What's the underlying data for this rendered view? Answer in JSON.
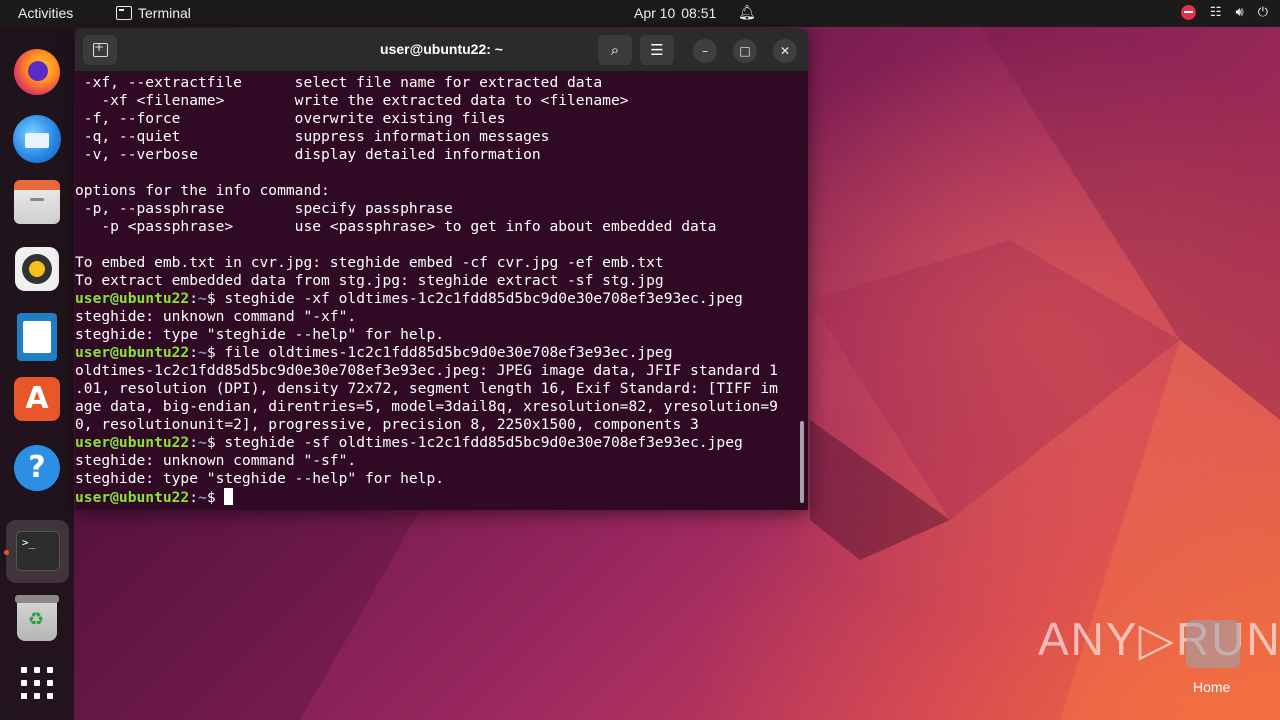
{
  "topbar": {
    "activities": "Activities",
    "app_name": "Terminal",
    "date": "Apr 10",
    "time": "08:51"
  },
  "window": {
    "title": "user@ubuntu22: ~"
  },
  "terminal": {
    "prompt_user": "user@ubuntu22",
    "prompt_path": "~",
    "lines": [
      {
        "type": "out",
        "text": " -xf, --extractfile      select file name for extracted data"
      },
      {
        "type": "out",
        "text": "   -xf <filename>        write the extracted data to <filename>"
      },
      {
        "type": "out",
        "text": " -f, --force             overwrite existing files"
      },
      {
        "type": "out",
        "text": " -q, --quiet             suppress information messages"
      },
      {
        "type": "out",
        "text": " -v, --verbose           display detailed information"
      },
      {
        "type": "out",
        "text": ""
      },
      {
        "type": "out",
        "text": "options for the info command:"
      },
      {
        "type": "out",
        "text": " -p, --passphrase        specify passphrase"
      },
      {
        "type": "out",
        "text": "   -p <passphrase>       use <passphrase> to get info about embedded data"
      },
      {
        "type": "out",
        "text": ""
      },
      {
        "type": "out",
        "text": "To embed emb.txt in cvr.jpg: steghide embed -cf cvr.jpg -ef emb.txt"
      },
      {
        "type": "out",
        "text": "To extract embedded data from stg.jpg: steghide extract -sf stg.jpg"
      },
      {
        "type": "cmd",
        "text": " steghide -xf oldtimes-1c2c1fdd85d5bc9d0e30e708ef3e93ec.jpeg"
      },
      {
        "type": "out",
        "text": "steghide: unknown command \"-xf\"."
      },
      {
        "type": "out",
        "text": "steghide: type \"steghide --help\" for help."
      },
      {
        "type": "cmd",
        "text": " file oldtimes-1c2c1fdd85d5bc9d0e30e708ef3e93ec.jpeg"
      },
      {
        "type": "out",
        "text": "oldtimes-1c2c1fdd85d5bc9d0e30e708ef3e93ec.jpeg: JPEG image data, JFIF standard 1"
      },
      {
        "type": "out",
        "text": ".01, resolution (DPI), density 72x72, segment length 16, Exif Standard: [TIFF im"
      },
      {
        "type": "out",
        "text": "age data, big-endian, direntries=5, model=3dail8q, xresolution=82, yresolution=9"
      },
      {
        "type": "out",
        "text": "0, resolutionunit=2], progressive, precision 8, 2250x1500, components 3"
      },
      {
        "type": "cmd",
        "text": " steghide -sf oldtimes-1c2c1fdd85d5bc9d0e30e708ef3e93ec.jpeg"
      },
      {
        "type": "out",
        "text": "steghide: unknown command \"-sf\"."
      },
      {
        "type": "out",
        "text": "steghide: type \"steghide --help\" for help."
      },
      {
        "type": "cmd",
        "text": " "
      }
    ]
  },
  "desktop": {
    "watermark": "ANY▷RUN",
    "home_label": "Home"
  },
  "dock": {
    "items": [
      "firefox-icon",
      "thunderbird-icon",
      "files-icon",
      "rhythmbox-icon",
      "libreoffice-writer-icon",
      "app-center-icon",
      "help-icon",
      "terminal-icon",
      "trash-icon",
      "show-apps-icon"
    ]
  },
  "colors": {
    "terminal_bg": "#300a24",
    "prompt_user": "#8ae234",
    "prompt_path": "#729fcf",
    "accent": "#e95420"
  }
}
